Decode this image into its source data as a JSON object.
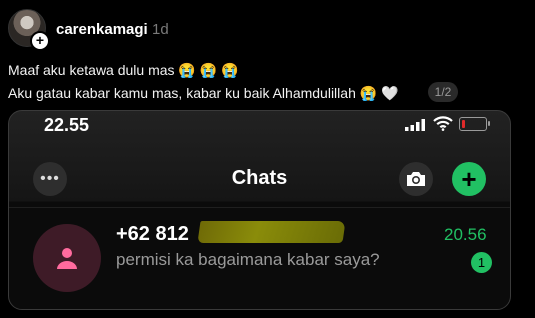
{
  "post": {
    "username": "carenkamagi",
    "timestamp": "1d",
    "caption_line1": "Maaf aku ketawa dulu mas 😭 😭 😭",
    "caption_line2": "Aku gatau kabar kamu mas, kabar ku baik Alhamdulillah 😭 🤍",
    "pager": "1/2"
  },
  "phone": {
    "status_time": "22.55",
    "title": "Chats",
    "chat": {
      "name": "+62 812",
      "time": "20.56",
      "message": "permisi ka bagaimana kabar saya?",
      "unread": "1"
    }
  },
  "colors": {
    "accent_green": "#21c063",
    "redaction": "#7d7f09",
    "battery_low": "#e02a2a"
  },
  "icons": [
    "plus-icon",
    "ellipsis-icon",
    "camera-icon",
    "signal-icon",
    "wifi-icon",
    "battery-icon",
    "person-icon"
  ]
}
